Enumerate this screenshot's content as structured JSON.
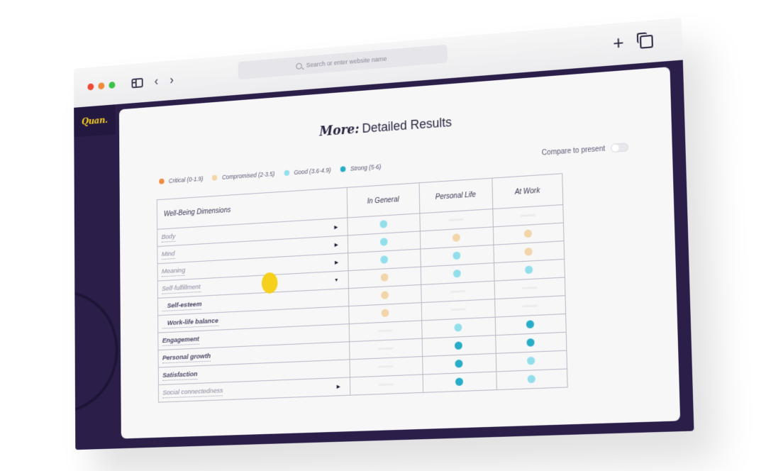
{
  "browser": {
    "address_placeholder": "Search or enter website name",
    "icons": {
      "sidebar": "sidebar-icon",
      "back": "‹",
      "forward": "›",
      "new_tab": "+",
      "tabs": "tabs-icon"
    }
  },
  "app": {
    "logo": "Quan.",
    "title_emphasis": "More:",
    "title_rest": "Detailed Results",
    "compare_label": "Compare to present",
    "compare_enabled": false
  },
  "legend": [
    {
      "label": "Critical (0-1.9)",
      "color": "#ef8a3e"
    },
    {
      "label": "Compromised (2-3.5)",
      "color": "#f2d5a8"
    },
    {
      "label": "Good (3.6-4.9)",
      "color": "#92dfeb"
    },
    {
      "label": "Strong (5-6)",
      "color": "#27adc8"
    }
  ],
  "table": {
    "headers": [
      "Well-Being Dimensions",
      "In General",
      "Personal Life",
      "At Work"
    ],
    "rows": [
      {
        "label": "Body",
        "level": "top",
        "caret": "right",
        "values": [
          "good",
          null,
          null
        ]
      },
      {
        "label": "Mind",
        "level": "top",
        "caret": "right",
        "values": [
          "good",
          "compromised",
          "compromised"
        ]
      },
      {
        "label": "Meaning",
        "level": "top",
        "caret": "right",
        "values": [
          "good",
          "good",
          "compromised"
        ]
      },
      {
        "label": "Self-fulfillment",
        "level": "top",
        "caret": "down",
        "values": [
          "compromised",
          "good",
          "good"
        ]
      },
      {
        "label": "Self-esteem",
        "level": "sub",
        "caret": null,
        "values": [
          "compromised",
          null,
          null
        ]
      },
      {
        "label": "Work-life balance",
        "level": "sub",
        "caret": null,
        "values": [
          "compromised",
          null,
          null
        ]
      },
      {
        "label": "Engagement",
        "level": "main",
        "caret": null,
        "values": [
          null,
          "good",
          "strong"
        ]
      },
      {
        "label": "Personal growth",
        "level": "main",
        "caret": null,
        "values": [
          null,
          "strong",
          "strong"
        ]
      },
      {
        "label": "Satisfaction",
        "level": "main",
        "caret": null,
        "values": [
          null,
          "strong",
          "good"
        ]
      },
      {
        "label": "Social connectedness",
        "level": "top",
        "caret": "right",
        "values": [
          null,
          "strong",
          "good"
        ]
      }
    ]
  },
  "status_colors": {
    "critical": "#ef8a3e",
    "compromised": "#f2d5a8",
    "good": "#92dfeb",
    "strong": "#27adc8"
  },
  "accent": {
    "frame": "#2b1f4a",
    "logo": "#f2cc1c",
    "cursor": "#f4cf12"
  }
}
